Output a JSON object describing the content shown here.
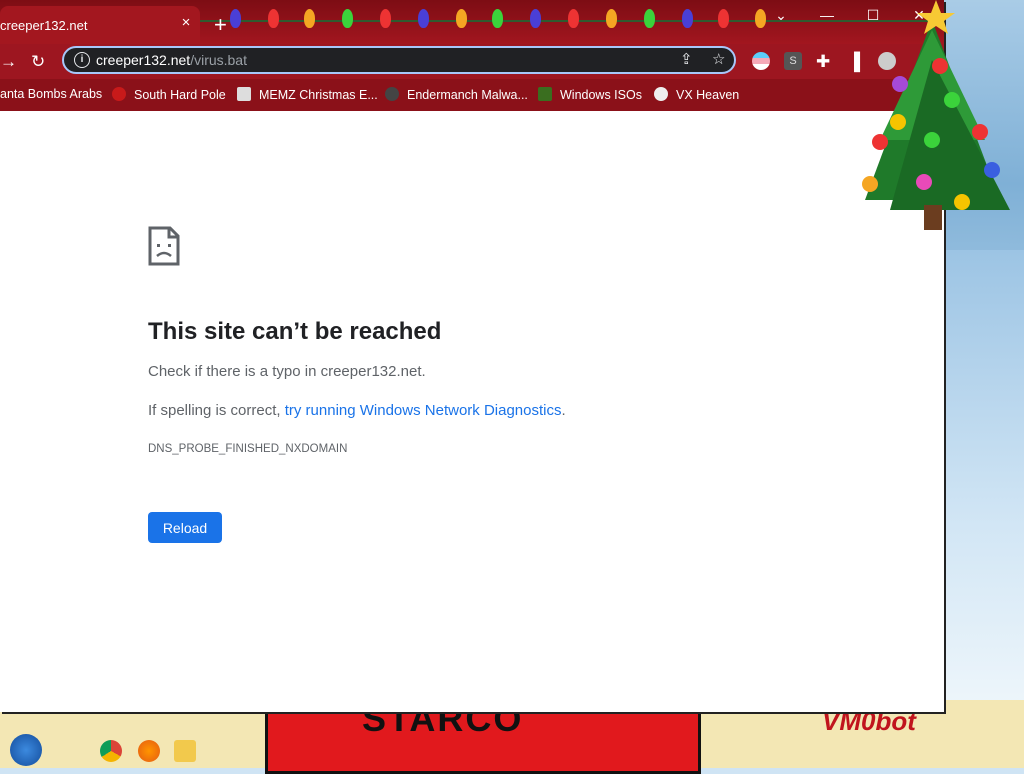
{
  "tab": {
    "title": "creeper132.net",
    "close_glyph": "×",
    "new_tab_glyph": "+"
  },
  "window_controls": {
    "dropdown_glyph": "⌄",
    "minimize_glyph": "—",
    "maximize_glyph": "☐",
    "close_glyph": "✕"
  },
  "toolbar": {
    "forward_glyph": "→",
    "reload_glyph": "↻"
  },
  "omnibox": {
    "host": "creeper132.net",
    "path": "/virus.bat",
    "info_glyph": "i",
    "share_glyph": "⇪",
    "star_glyph": "☆"
  },
  "extensions": {
    "ext2_label": "S",
    "puzzle_glyph": "✚",
    "sidepanel_glyph": "▐"
  },
  "bookmarks": [
    {
      "label": "anta Bombs Arabs",
      "icon": "none"
    },
    {
      "label": "South Hard Pole",
      "icon": "red-splat-icon"
    },
    {
      "label": "MEMZ Christmas E...",
      "icon": "image-icon"
    },
    {
      "label": "Endermanch Malwa...",
      "icon": "enderman-icon"
    },
    {
      "label": "Windows ISOs",
      "icon": "tree-icon"
    },
    {
      "label": "VX Heaven",
      "icon": "skull-icon"
    }
  ],
  "error_page": {
    "title": "This site can’t be reached",
    "line1": "Check if there is a typo in creeper132.net.",
    "line2_prefix": "If spelling is correct, ",
    "line2_link": "try running Windows Network Diagnostics",
    "line2_suffix": ".",
    "error_code": "DNS_PROBE_FINISHED_NXDOMAIN",
    "reload_label": "Reload"
  },
  "wallpaper": {
    "red_text": "STARCO",
    "signature": "VM0bot"
  },
  "colors": {
    "titlebar": "#a3171f",
    "accent_blue": "#1a73e8",
    "omnibox_bg": "#202124"
  }
}
